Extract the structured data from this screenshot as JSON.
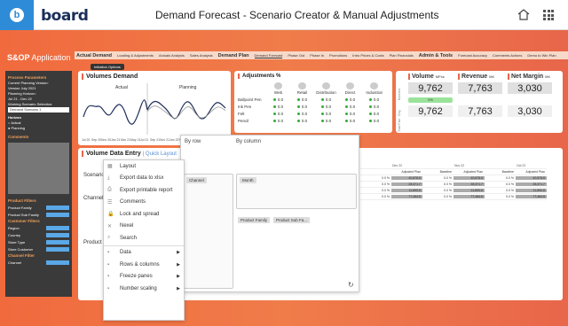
{
  "header": {
    "brand": "board",
    "title": "Demand Forecast - Scenario Creator & Manual Adjustments"
  },
  "app_label": {
    "prefix": "S&OP",
    "suffix": " Application"
  },
  "nav": [
    {
      "label": "Actual Demand",
      "group": true
    },
    {
      "label": "Loading & Adjustments"
    },
    {
      "label": "Actuals Analysis"
    },
    {
      "label": "Sales Analysis"
    },
    {
      "label": "Demand Plan",
      "group": true
    },
    {
      "label": "Demand Forecast",
      "active": true
    },
    {
      "label": "Phase Out"
    },
    {
      "label": "Phase In"
    },
    {
      "label": "Promotions"
    },
    {
      "label": "Intro Prices & Costs"
    },
    {
      "label": "Plan Financials"
    },
    {
      "label": "Admin & Tools",
      "group": true
    },
    {
      "label": "Forecast Accuracy"
    },
    {
      "label": "Comments Actions"
    },
    {
      "label": "Demo to Win Plan"
    }
  ],
  "subnav": "Initiation Options",
  "sidebar": {
    "process_title": "Process Parameters",
    "current_version_label": "Current Planning Version:",
    "current_version": "Version July 2021",
    "horizon_label": "Planning Horizon:",
    "horizon": "Jul 21 - Dec 22",
    "scenario_label": "Working Scenario Selection:",
    "scenario": "Demand Scenario 1",
    "horizon_h": "Horizon",
    "actual": "Actual",
    "planning": "Planning",
    "comments": "Comments",
    "product_filters": "Product Filters",
    "product_family": "Product Family",
    "product_sub_family": "Product Sub Family",
    "customer_filters": "Customer Filters",
    "region": "Region",
    "country": "Country",
    "store_type": "Store Type",
    "store_customer": "Store Customer",
    "channel_filter": "Channel Filter",
    "channel": "Channel"
  },
  "volumes_demand": {
    "title": "Volumes Demand",
    "actual_label": "Actual",
    "planning_label": "Planning",
    "x_ticks": [
      "Jul 20",
      "Sep 20",
      "Nov 20",
      "Jan 21",
      "Mar 21",
      "May 21",
      "Jul 21",
      "Sep 21",
      "Nov 21",
      "Jan 22",
      "Mar 22",
      "May 22",
      "Jul 22",
      "Sep 22",
      "Nov 22"
    ]
  },
  "adjustments": {
    "title": "Adjustments %",
    "columns": [
      "Web",
      "Retail",
      "Distribution",
      "Direct",
      "Industrial"
    ],
    "rows": [
      {
        "label": "Ballpoint Pen",
        "values": [
          "0.0",
          "0.0",
          "0.0",
          "0.0",
          "0.0"
        ]
      },
      {
        "label": "Ink Pen",
        "values": [
          "0.0",
          "0.0",
          "0.0",
          "0.0",
          "0.0"
        ]
      },
      {
        "label": "Felt",
        "values": [
          "0.0",
          "0.0",
          "0.0",
          "0.0",
          "0.0"
        ]
      },
      {
        "label": "Pencil",
        "values": [
          "0.0",
          "0.0",
          "0.0",
          "0.0",
          "0.0"
        ]
      }
    ]
  },
  "kpis": {
    "row_labels": [
      "Baseline",
      "Chg",
      "Total Plan"
    ],
    "items": [
      {
        "title": "Volume",
        "unit": "MPcs",
        "baseline": "9,762",
        "total": "9,762",
        "chg": "0%"
      },
      {
        "title": "Revenue",
        "unit": "MK",
        "baseline": "7,763",
        "total": "7,763"
      },
      {
        "title": "Net Margin",
        "unit": "MK",
        "baseline": "3,030",
        "total": "3,030"
      }
    ]
  },
  "volume_entry": {
    "title": "Volume Data Entry",
    "quick_layout": "Quick Layout",
    "scenario": "Scenario",
    "channel": "Channel",
    "product": "Product"
  },
  "context_menu": {
    "items": [
      "Layout",
      "Export data to xlsx",
      "Export printable report",
      "Comments",
      "Lock and spread",
      "Nexel",
      "Search"
    ],
    "submenu_items": [
      "Data",
      "Rows & columns",
      "Freeze panes",
      "Number scaling"
    ]
  },
  "layout_panel": {
    "by_row": "By row",
    "by_column": "By column",
    "row_chip": "Channel",
    "col_chip": "Month",
    "filter_chips": [
      "Product Family",
      "Product Sub Fa..."
    ]
  },
  "table": {
    "months": [
      "Dec 22",
      "Nov 22",
      "Oct 22"
    ],
    "headers": [
      "Adjusted Plan",
      "Baseline",
      "Adjusted Plan",
      "Baseline",
      "Adjusted Plan"
    ],
    "rows": [
      [
        "0.0 %",
        "40,878.8",
        "0.0 %",
        "40,878.8",
        "0.0 %",
        "40,878.8"
      ],
      [
        "0.0 %",
        "28,371.7",
        "0.0 %",
        "28,371.7",
        "0.0 %",
        "28,371.7"
      ],
      [
        "0.0 %",
        "11,890.8",
        "0.0 %",
        "11,890.8",
        "0.0 %",
        "11,890.8"
      ],
      [
        "0.0 %",
        "77,484.8",
        "0.0 %",
        "77,484.8",
        "0.0 %",
        "77,484.8"
      ]
    ]
  }
}
